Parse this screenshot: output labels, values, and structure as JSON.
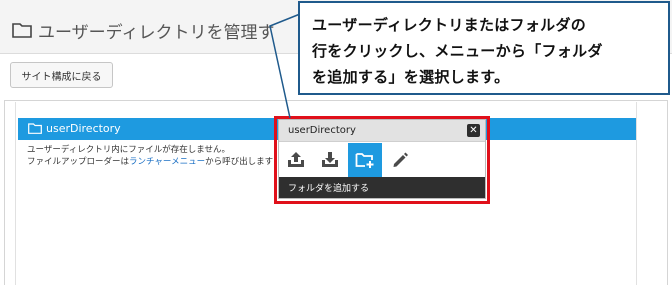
{
  "header": {
    "title": "ユーザーディレクトリを管理す",
    "title_icon": "folder-outline-icon"
  },
  "toolbar": {
    "back_label": "サイト構成に戻る"
  },
  "directory": {
    "row_label": "userDirectory",
    "row_icon": "folder-outline-icon",
    "empty_message": "ユーザーディレクトリ内にファイルが存在しません。",
    "hint_prefix": "ファイルアップローダーは",
    "hint_link": "ランチャーメニュー",
    "hint_suffix": "から呼び出します"
  },
  "popup": {
    "title": "userDirectory",
    "close_icon": "close-icon",
    "tools": [
      {
        "name": "upload-icon",
        "active": false
      },
      {
        "name": "download-icon",
        "active": false
      },
      {
        "name": "add-folder-icon",
        "active": true
      },
      {
        "name": "edit-pencil-icon",
        "active": false
      }
    ],
    "hover_label": "フォルダを追加する"
  },
  "callout": {
    "lines": [
      "ユーザーディレクトリまたはフォルダの",
      "行をクリックし、メニューから「フォルダ",
      "を追加する」を選択します。"
    ]
  },
  "colors": {
    "accent_blue": "#1e9ae0",
    "highlight_red": "#e0101a",
    "callout_border": "#1f5a8c",
    "popup_footer": "#2f2f2f"
  }
}
